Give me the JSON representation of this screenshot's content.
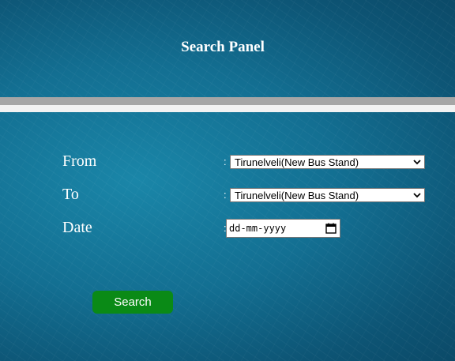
{
  "header": {
    "title": "Search Panel"
  },
  "form": {
    "from": {
      "label": "From",
      "colon": ":",
      "value": "Tirunelveli(New Bus Stand)"
    },
    "to": {
      "label": "To",
      "colon": ":",
      "value": "Tirunelveli(New Bus Stand)"
    },
    "date": {
      "label": "Date",
      "colon": ":",
      "placeholder": "dd-mm-yyyy"
    },
    "search_label": "Search"
  },
  "colors": {
    "background": "#136f92",
    "button": "#0a8a16",
    "divider_gray": "#a6a6a6",
    "divider_white": "#f2f2f2"
  },
  "icons": {
    "select_arrow": "chevron-down-icon",
    "date_picker": "calendar-icon"
  }
}
